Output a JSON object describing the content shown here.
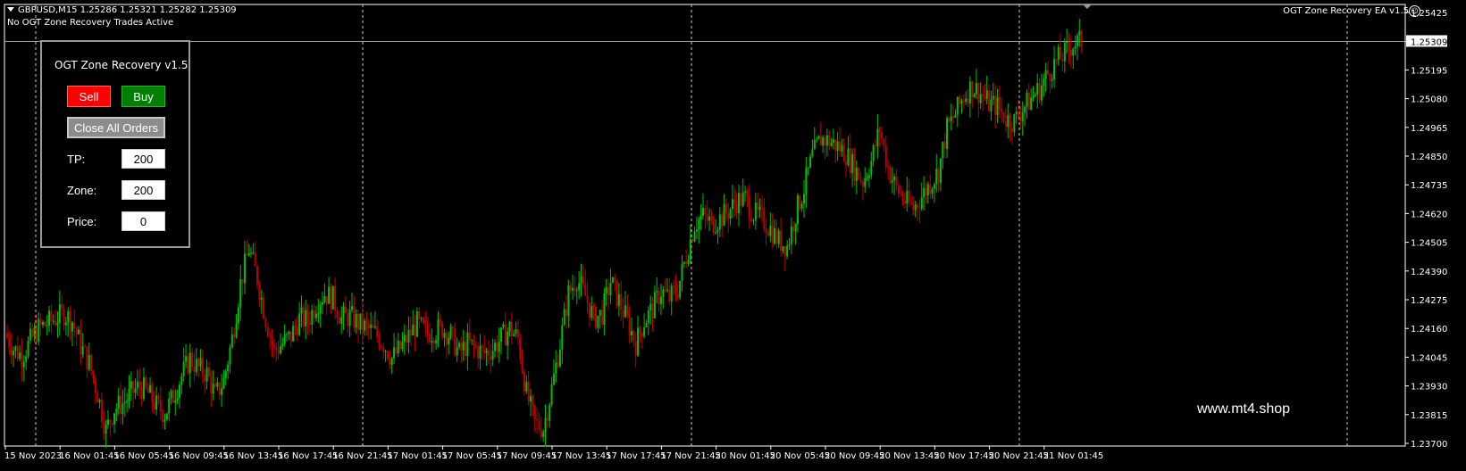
{
  "header": {
    "symbol_line": "GBPUSD,M15  1.25286 1.25321 1.25282 1.25309",
    "status": "No OGT Zone Recovery Trades Active",
    "ea_name": "OGT Zone Recovery EA  v1.5",
    "ea_icon": "smiley-icon"
  },
  "panel": {
    "title": "OGT Zone Recovery v1.5",
    "sell_label": "Sell",
    "buy_label": "Buy",
    "close_label": "Close All Orders",
    "tp_label": "TP:",
    "tp_value": "200",
    "zone_label": "Zone:",
    "zone_value": "200",
    "price_label": "Price:",
    "price_value": "0"
  },
  "watermark": "www.mt4.shop",
  "colors": {
    "background": "#000000",
    "bull": "#00c000",
    "bear": "#c00000",
    "grid": "#c8c8c8",
    "axis": "#ffffff"
  },
  "chart_data": {
    "type": "candlestick",
    "symbol": "GBPUSD",
    "timeframe": "M15",
    "last_price": "1.25309",
    "ylim": [
      1.237,
      1.2545
    ],
    "y_ticks": [
      "1.25425",
      "1.25309",
      "1.25195",
      "1.25080",
      "1.24965",
      "1.24850",
      "1.24735",
      "1.24620",
      "1.24505",
      "1.24390",
      "1.24275",
      "1.24160",
      "1.24045",
      "1.23930",
      "1.23815",
      "1.23700"
    ],
    "y_tick_values": [
      1.25425,
      1.25309,
      1.25195,
      1.2508,
      1.24965,
      1.2485,
      1.24735,
      1.2462,
      1.24505,
      1.2439,
      1.24275,
      1.2416,
      1.24045,
      1.2393,
      1.23815,
      1.237
    ],
    "x_ticks": [
      "15 Nov 2023",
      "16 Nov 01:45",
      "16 Nov 05:45",
      "16 Nov 09:45",
      "16 Nov 13:45",
      "16 Nov 17:45",
      "16 Nov 21:45",
      "17 Nov 01:45",
      "17 Nov 05:45",
      "17 Nov 09:45",
      "17 Nov 13:45",
      "17 Nov 17:45",
      "17 Nov 21:45",
      "20 Nov 01:45",
      "20 Nov 05:45",
      "20 Nov 09:45",
      "20 Nov 13:45",
      "20 Nov 17:45",
      "20 Nov 21:45",
      "21 Nov 01:45"
    ],
    "closes": [
      1.2414,
      1.2408,
      1.2405,
      1.2411,
      1.2416,
      1.2418,
      1.242,
      1.2422,
      1.2419,
      1.2409,
      1.2402,
      1.239,
      1.2375,
      1.2384,
      1.2386,
      1.239,
      1.2393,
      1.239,
      1.2385,
      1.2382,
      1.2389,
      1.2397,
      1.2404,
      1.24,
      1.2398,
      1.2389,
      1.2395,
      1.2412,
      1.2434,
      1.2448,
      1.2436,
      1.242,
      1.2407,
      1.241,
      1.2413,
      1.242,
      1.2419,
      1.2426,
      1.243,
      1.2428,
      1.242,
      1.2421,
      1.2418,
      1.2416,
      1.2414,
      1.241,
      1.2404,
      1.2408,
      1.2413,
      1.2418,
      1.2414,
      1.2415,
      1.2416,
      1.2413,
      1.2406,
      1.241,
      1.2408,
      1.2406,
      1.2408,
      1.2412,
      1.2416,
      1.2412,
      1.239,
      1.2378,
      1.2376,
      1.2392,
      1.241,
      1.243,
      1.2436,
      1.2429,
      1.242,
      1.2422,
      1.2435,
      1.2427,
      1.2419,
      1.241,
      1.2419,
      1.2424,
      1.2431,
      1.2428,
      1.2432,
      1.2445,
      1.2458,
      1.2461,
      1.2458,
      1.246,
      1.2463,
      1.2467,
      1.2468,
      1.2462,
      1.246,
      1.2456,
      1.2451,
      1.2449,
      1.2462,
      1.2472,
      1.2485,
      1.2492,
      1.2491,
      1.2489,
      1.2486,
      1.248,
      1.2475,
      1.2483,
      1.2496,
      1.248,
      1.2472,
      1.2467,
      1.2464,
      1.2469,
      1.2474,
      1.2479,
      1.2496,
      1.2502,
      1.2509,
      1.2513,
      1.251,
      1.2506,
      1.2505,
      1.25,
      1.2499,
      1.2504,
      1.2508,
      1.2512,
      1.2518,
      1.2523,
      1.2526,
      1.253,
      1.2531
    ],
    "candles_note": "",
    "y_cursor_line": 1.25309
  }
}
